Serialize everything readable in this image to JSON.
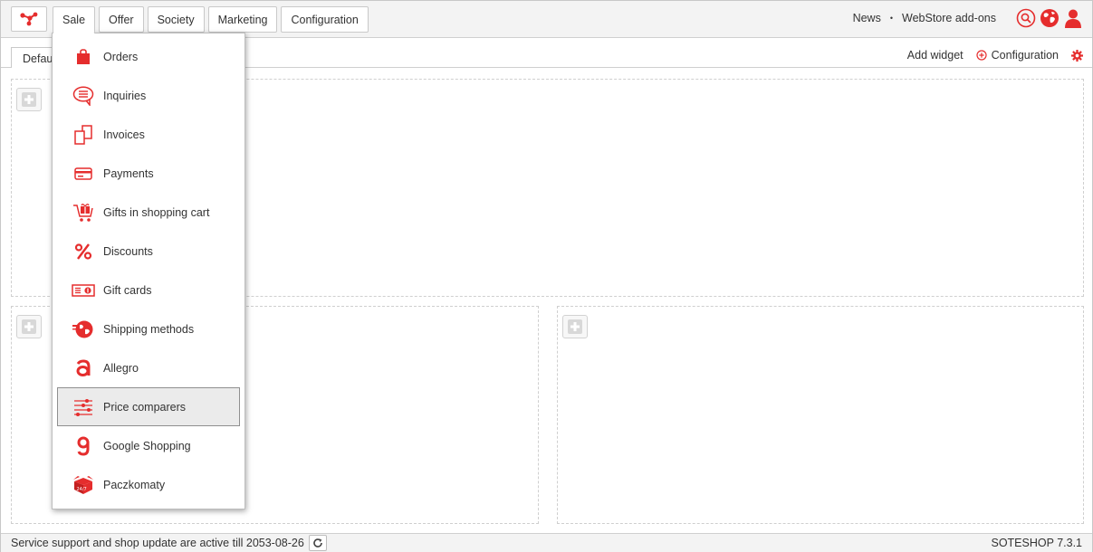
{
  "colors": {
    "accent": "#e52d2d",
    "bar_bg": "#f3f3f3",
    "border": "#c9c9c9"
  },
  "nav": {
    "tabs": [
      {
        "label": "Sale",
        "active": true
      },
      {
        "label": "Offer"
      },
      {
        "label": "Society"
      },
      {
        "label": "Marketing"
      },
      {
        "label": "Configuration"
      }
    ]
  },
  "top_links": {
    "news": "News",
    "separator": "•",
    "addons": "WebStore add-ons"
  },
  "top_icons": [
    "search-icon",
    "globe-icon",
    "user-icon"
  ],
  "dashboard": {
    "tab_label": "Default",
    "add_widget": "Add widget",
    "configuration": "Configuration"
  },
  "sale_menu": {
    "items": [
      {
        "label": "Orders",
        "icon": "shopping-bag-icon"
      },
      {
        "label": "Inquiries",
        "icon": "speech-bubble-icon"
      },
      {
        "label": "Invoices",
        "icon": "documents-icon"
      },
      {
        "label": "Payments",
        "icon": "credit-card-icon"
      },
      {
        "label": "Gifts in shopping cart",
        "icon": "gift-cart-icon"
      },
      {
        "label": "Discounts",
        "icon": "percent-icon"
      },
      {
        "label": "Gift cards",
        "icon": "gift-card-icon"
      },
      {
        "label": "Shipping methods",
        "icon": "globe-shipping-icon"
      },
      {
        "label": "Allegro",
        "icon": "allegro-icon"
      },
      {
        "label": "Price comparers",
        "icon": "sliders-icon",
        "highlighted": true
      },
      {
        "label": "Google Shopping",
        "icon": "google-g-icon"
      },
      {
        "label": "Paczkomaty",
        "icon": "parcel-box-icon"
      }
    ]
  },
  "footer": {
    "status": "Service support and shop update are active till 2053-08-26",
    "version": "SOTESHOP 7.3.1"
  }
}
